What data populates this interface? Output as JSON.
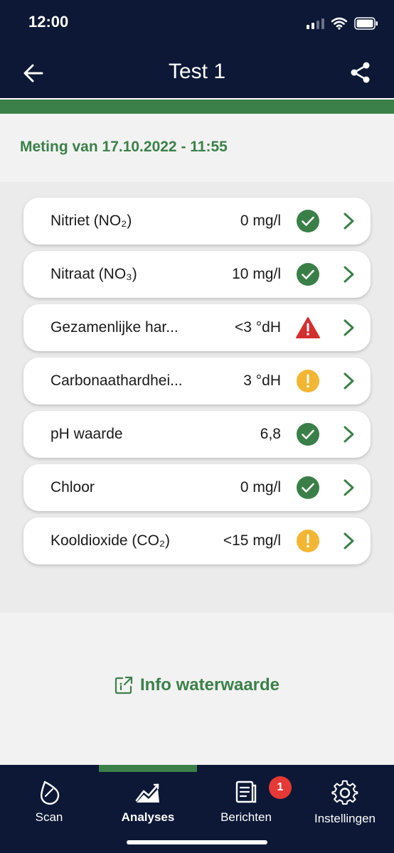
{
  "status_bar": {
    "time": "12:00"
  },
  "header": {
    "title": "Test 1"
  },
  "measurement": {
    "date_label": "Meting van 17.10.2022 - 11:55"
  },
  "rows": [
    {
      "name": "Nitriet (NO₂)",
      "value": "0 mg/l",
      "status": "ok"
    },
    {
      "name": "Nitraat (NO₃)",
      "value": "10 mg/l",
      "status": "ok"
    },
    {
      "name": "Gezamenlijke har...",
      "value": "<3 °dH",
      "status": "alert"
    },
    {
      "name": "Carbonaathardhei...",
      "value": "3 °dH",
      "status": "warning"
    },
    {
      "name": "pH waarde",
      "value": "6,8",
      "status": "ok"
    },
    {
      "name": "Chloor",
      "value": "0 mg/l",
      "status": "ok"
    },
    {
      "name": "Kooldioxide (CO₂)",
      "value": "<15 mg/l",
      "status": "warning"
    }
  ],
  "info": {
    "link_label": "Info waterwaarde"
  },
  "tabs": [
    {
      "label": "Scan",
      "icon": "drop-icon"
    },
    {
      "label": "Analyses",
      "icon": "chart-icon",
      "active": true
    },
    {
      "label": "Berichten",
      "icon": "document-icon",
      "badge": "1"
    },
    {
      "label": "Instellingen",
      "icon": "gear-icon"
    }
  ],
  "colors": {
    "navy": "#0c1836",
    "accent_green": "#3b8049",
    "status_ok": "#3a7f47",
    "status_warning": "#f2b632",
    "status_alert": "#d32f2f",
    "badge": "#e53935"
  }
}
